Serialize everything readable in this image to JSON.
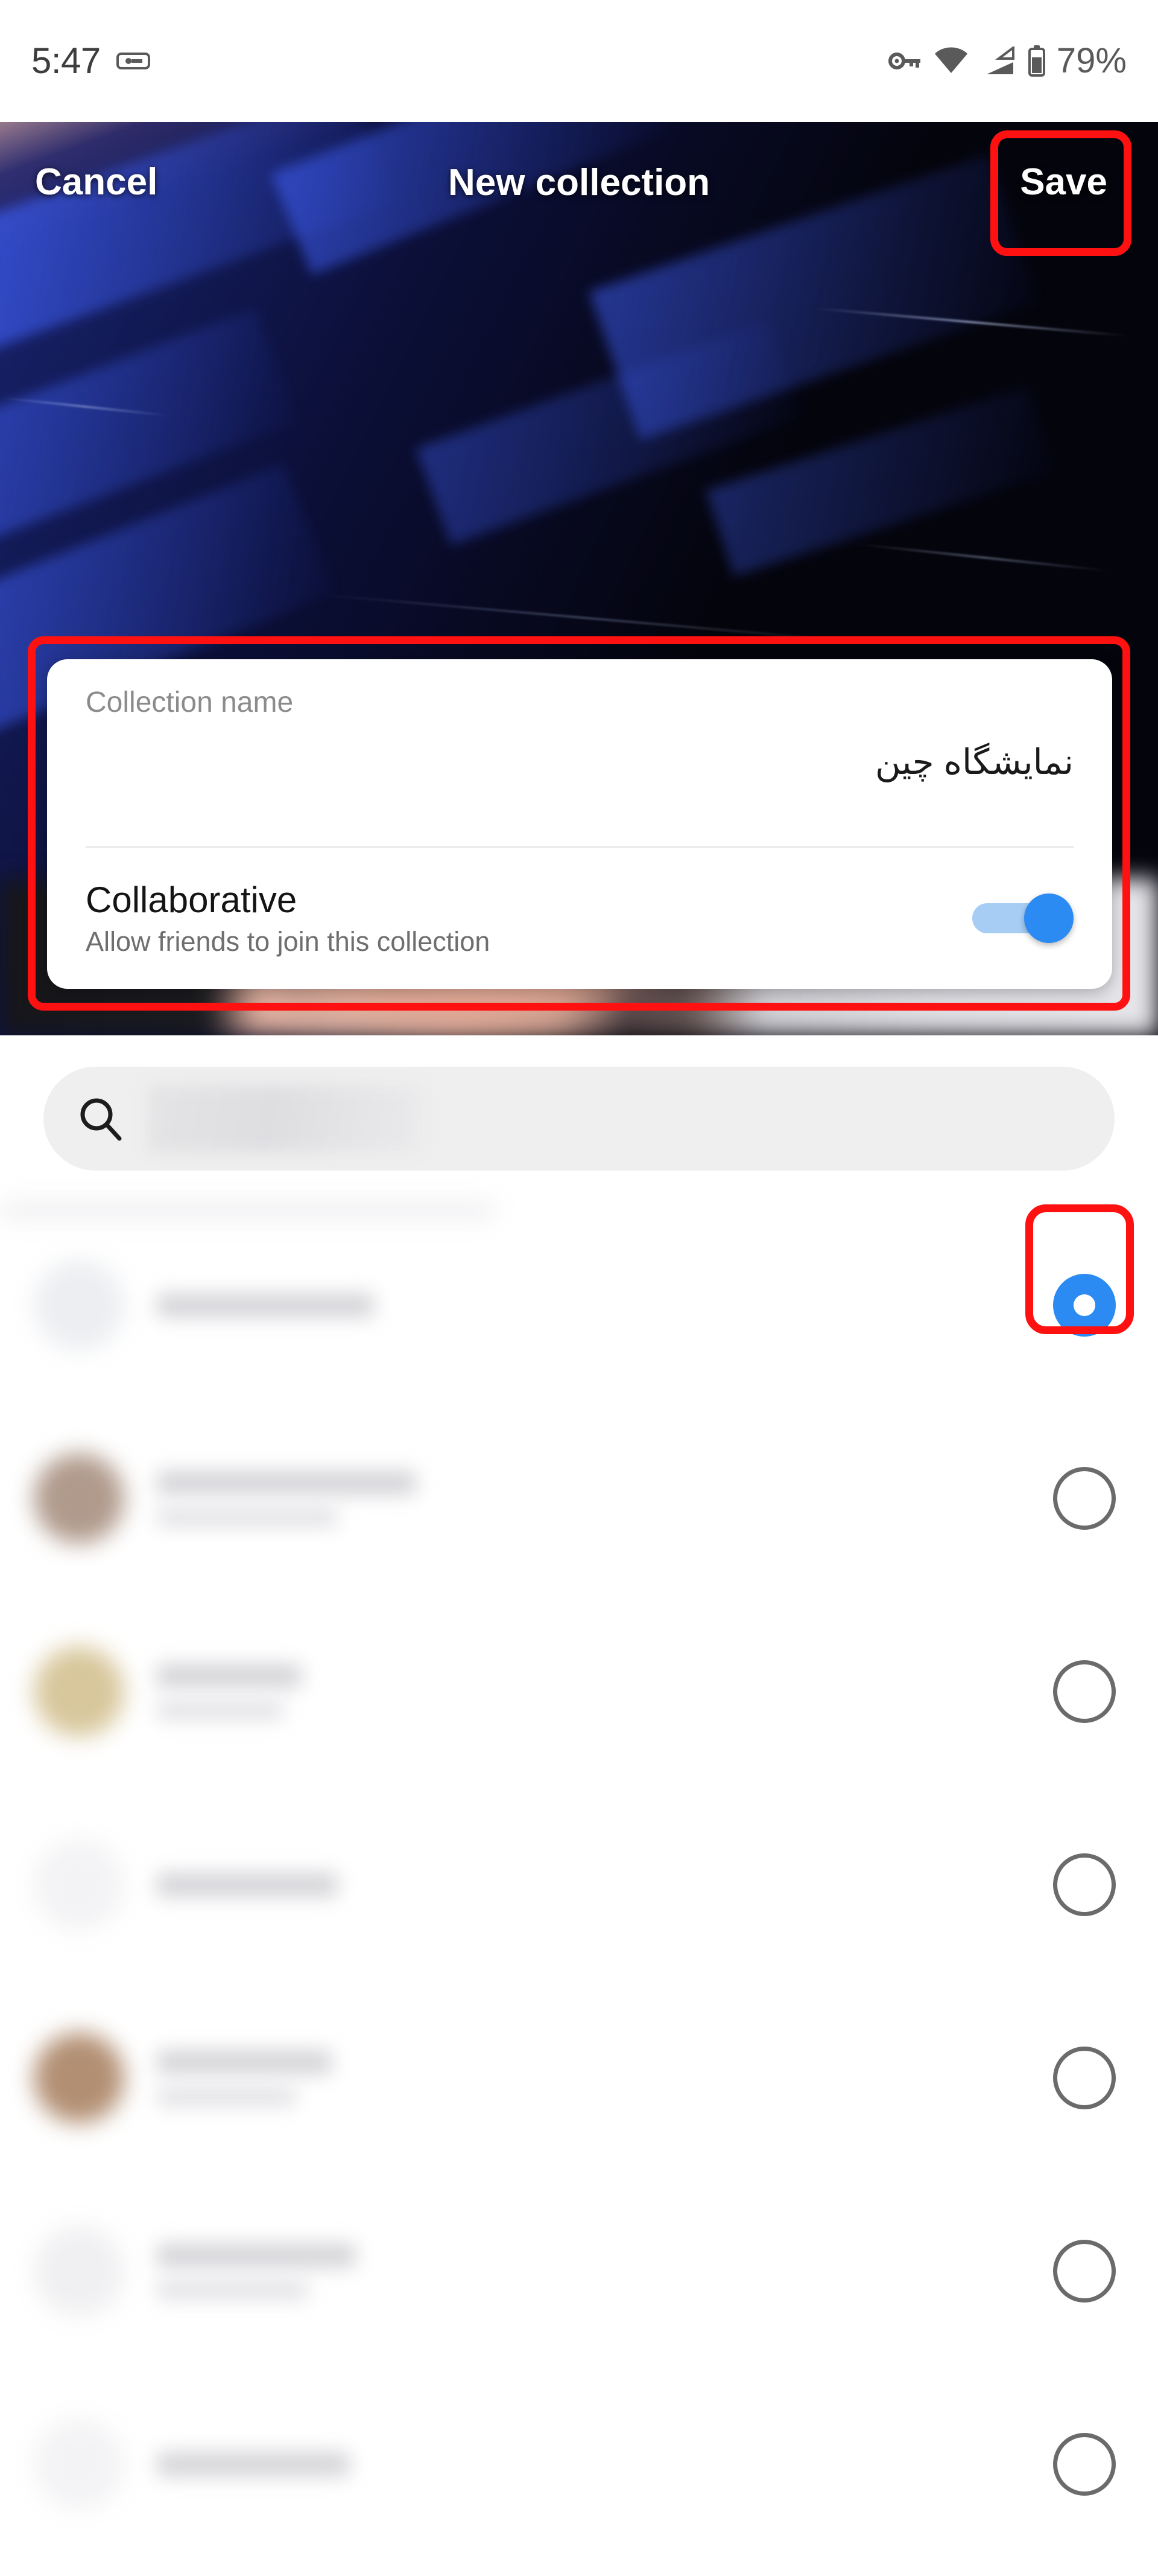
{
  "status_bar": {
    "time": "5:47",
    "battery_percent": "79%",
    "icons": [
      "vpn-key-badge-icon",
      "key-icon",
      "wifi-icon",
      "cellular-signal-icon",
      "battery-icon"
    ]
  },
  "app_bar": {
    "cancel_label": "Cancel",
    "title": "New collection",
    "save_label": "Save"
  },
  "card": {
    "name_label": "Collection name",
    "name_value": "نمایشگاه چین",
    "collaborative_title": "Collaborative",
    "collaborative_subtitle": "Allow friends to join this collection",
    "collaborative_enabled": "true"
  },
  "search": {
    "icon": "search-icon",
    "placeholder": ""
  },
  "list": {
    "selected_index": 0,
    "rows": [
      {
        "name": "",
        "subtitle": "",
        "avatar_color": "#eceef1",
        "selected": true,
        "name_width": 360,
        "sub_width": 0,
        "show_top_fade": true
      },
      {
        "name": "",
        "subtitle": "",
        "avatar_color": "#b09a8c",
        "selected": false,
        "name_width": 430,
        "sub_width": 300,
        "show_top_fade": false
      },
      {
        "name": "",
        "subtitle": "",
        "avatar_color": "#d8c79c",
        "selected": false,
        "name_width": 240,
        "sub_width": 210,
        "show_top_fade": false
      },
      {
        "name": "",
        "subtitle": "",
        "avatar_color": "#f3f3f5",
        "selected": false,
        "name_width": 300,
        "sub_width": 0,
        "show_top_fade": false
      },
      {
        "name": "",
        "subtitle": "",
        "avatar_color": "#b28f73",
        "selected": false,
        "name_width": 290,
        "sub_width": 230,
        "show_top_fade": false
      },
      {
        "name": "",
        "subtitle": "",
        "avatar_color": "#f0f0f2",
        "selected": false,
        "name_width": 330,
        "sub_width": 250,
        "show_top_fade": false
      },
      {
        "name": "",
        "subtitle": "",
        "avatar_color": "#f3f3f5",
        "selected": false,
        "name_width": 320,
        "sub_width": 0,
        "show_top_fade": false
      }
    ]
  },
  "highlights": {
    "color": "#ff1111",
    "targets": [
      "save-button",
      "collection-card",
      "selected-radio"
    ]
  }
}
